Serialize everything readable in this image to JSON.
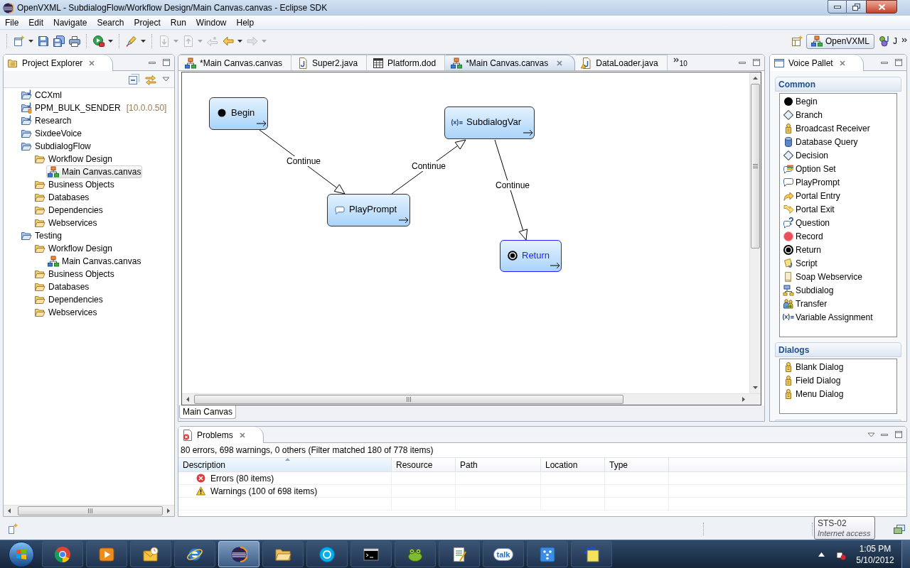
{
  "window": {
    "title": "OpenVXML - SubdialogFlow/Workflow Design/Main Canvas.canvas - Eclipse SDK"
  },
  "menu": [
    "File",
    "Edit",
    "Navigate",
    "Search",
    "Project",
    "Run",
    "Window",
    "Help"
  ],
  "toolbar": {
    "groups": [
      {
        "items": [
          {
            "kind": "new",
            "dropdown": true,
            "disabled": false
          },
          {
            "kind": "save",
            "dropdown": false,
            "disabled": false
          },
          {
            "kind": "saveall",
            "dropdown": false,
            "disabled": false
          },
          {
            "kind": "print",
            "dropdown": false,
            "disabled": false
          }
        ]
      },
      {
        "items": [
          {
            "kind": "run",
            "dropdown": true,
            "disabled": false
          }
        ]
      },
      {
        "items": [
          {
            "kind": "marker",
            "dropdown": true,
            "disabled": false
          }
        ]
      },
      {
        "items": [
          {
            "kind": "next",
            "dropdown": true,
            "disabled": true
          },
          {
            "kind": "previous",
            "dropdown": true,
            "disabled": true
          },
          {
            "kind": "lastedit",
            "dropdown": false,
            "disabled": true
          },
          {
            "kind": "back",
            "dropdown": true,
            "disabled": false
          },
          {
            "kind": "forward",
            "dropdown": true,
            "disabled": true
          }
        ]
      }
    ]
  },
  "perspectives": [
    {
      "label": "OpenVXML",
      "kind": "canvas",
      "selected": true
    },
    {
      "label": "J",
      "kind": "java",
      "selected": false
    }
  ],
  "project_explorer": {
    "title": "Project Explorer",
    "tree": [
      {
        "label": "CCXml",
        "kind": "javaproject",
        "selected": false
      },
      {
        "label": "PPM_BULK_SENDER",
        "decoration": "[10.0.0.50]",
        "kind": "serverproject",
        "selected": false
      },
      {
        "label": "Research",
        "kind": "javaproject",
        "selected": false
      },
      {
        "label": "SixdeeVoice",
        "kind": "project",
        "selected": false
      },
      {
        "label": "SubdialogFlow",
        "kind": "project",
        "selected": false,
        "children": [
          {
            "label": "Workflow Design",
            "kind": "folder",
            "selected": false,
            "children": [
              {
                "label": "Main Canvas.canvas",
                "kind": "canvas",
                "selected": true
              }
            ]
          },
          {
            "label": "Business Objects",
            "kind": "folder",
            "selected": false
          },
          {
            "label": "Databases",
            "kind": "folder",
            "selected": false
          },
          {
            "label": "Dependencies",
            "kind": "folder",
            "selected": false
          },
          {
            "label": "Webservices",
            "kind": "folder",
            "selected": false
          }
        ]
      },
      {
        "label": "Testing",
        "kind": "project",
        "selected": false,
        "children": [
          {
            "label": "Workflow Design",
            "kind": "folder",
            "selected": false,
            "children": [
              {
                "label": "Main Canvas.canvas",
                "kind": "canvas",
                "selected": false
              }
            ]
          },
          {
            "label": "Business Objects",
            "kind": "folder",
            "selected": false
          },
          {
            "label": "Databases",
            "kind": "folder",
            "selected": false
          },
          {
            "label": "Dependencies",
            "kind": "folder",
            "selected": false
          },
          {
            "label": "Webservices",
            "kind": "folder",
            "selected": false
          }
        ]
      }
    ]
  },
  "editor": {
    "tabs": [
      {
        "label": "*Main Canvas.canvas",
        "kind": "canvas",
        "selected": false
      },
      {
        "label": "Super2.java",
        "kind": "java",
        "selected": false
      },
      {
        "label": "Platform.dod",
        "kind": "table",
        "selected": false
      },
      {
        "label": "*Main Canvas.canvas",
        "kind": "canvas",
        "selected": true
      },
      {
        "label": "DataLoader.java",
        "kind": "javawarning",
        "selected": false
      }
    ],
    "overflow_count": "10",
    "nodes": [
      {
        "label": "Begin",
        "kind": "begin",
        "selected": false
      },
      {
        "label": "SubdialogVar",
        "kind": "assignment",
        "selected": false
      },
      {
        "label": "PlayPrompt",
        "kind": "prompt",
        "selected": false
      },
      {
        "label": "Return",
        "kind": "return",
        "selected": true
      }
    ],
    "connections": [
      {
        "label": "Continue"
      },
      {
        "label": "Continue"
      },
      {
        "label": "Continue"
      }
    ],
    "page_tabs": [
      {
        "label": "Main Canvas",
        "selected": true
      }
    ]
  },
  "voice_pallet": {
    "title": "Voice Pallet",
    "groups": [
      {
        "title": "Common",
        "items": [
          {
            "label": "Begin",
            "kind": "begin"
          },
          {
            "label": "Branch",
            "kind": "branch"
          },
          {
            "label": "Broadcast Receiver",
            "kind": "receiver"
          },
          {
            "label": "Database Query",
            "kind": "database"
          },
          {
            "label": "Decision",
            "kind": "decision"
          },
          {
            "label": "Option Set",
            "kind": "options"
          },
          {
            "label": "PlayPrompt",
            "kind": "prompt"
          },
          {
            "label": "Portal Entry",
            "kind": "entry"
          },
          {
            "label": "Portal Exit",
            "kind": "exit"
          },
          {
            "label": "Question",
            "kind": "question"
          },
          {
            "label": "Record",
            "kind": "record"
          },
          {
            "label": "Return",
            "kind": "return"
          },
          {
            "label": "Script",
            "kind": "script"
          },
          {
            "label": "Soap Webservice",
            "kind": "webservice"
          },
          {
            "label": "Subdialog",
            "kind": "subdialog"
          },
          {
            "label": "Transfer",
            "kind": "transfer"
          },
          {
            "label": "Variable Assignment",
            "kind": "assignment"
          }
        ]
      },
      {
        "title": "Dialogs",
        "items": [
          {
            "label": "Blank Dialog",
            "kind": "dialog"
          },
          {
            "label": "Field Dialog",
            "kind": "dialog"
          },
          {
            "label": "Menu Dialog",
            "kind": "dialog"
          }
        ]
      }
    ]
  },
  "problems": {
    "title": "Problems",
    "summary": "80 errors, 698 warnings, 0 others (Filter matched 180 of 778 items)",
    "columns": [
      {
        "label": "Description",
        "sorted": true
      },
      {
        "label": "Resource",
        "sorted": false
      },
      {
        "label": "Path",
        "sorted": false
      },
      {
        "label": "Location",
        "sorted": false
      },
      {
        "label": "Type",
        "sorted": false
      }
    ],
    "rows": [
      {
        "kind": "error",
        "description": "Errors (80 items)"
      },
      {
        "kind": "warning",
        "description": "Warnings (100 of 698 items)"
      }
    ]
  },
  "status_tooltip": {
    "title": "STS-02",
    "detail": "Internet access"
  },
  "taskbar": {
    "apps": [
      {
        "kind": "chrome",
        "selected": false
      },
      {
        "kind": "player",
        "selected": false
      },
      {
        "kind": "mail",
        "selected": false
      },
      {
        "kind": "browser",
        "selected": false
      },
      {
        "kind": "eclipse",
        "selected": true
      },
      {
        "kind": "files",
        "selected": false
      },
      {
        "kind": "skype",
        "selected": false
      },
      {
        "kind": "console",
        "selected": false
      },
      {
        "kind": "frog",
        "selected": false
      },
      {
        "kind": "editor",
        "selected": false
      },
      {
        "kind": "talk",
        "logo_text": "talk",
        "selected": false
      },
      {
        "kind": "dots",
        "selected": false
      },
      {
        "kind": "paint",
        "selected": false
      }
    ],
    "time": "1:05 PM",
    "date": "5/10/2012"
  }
}
